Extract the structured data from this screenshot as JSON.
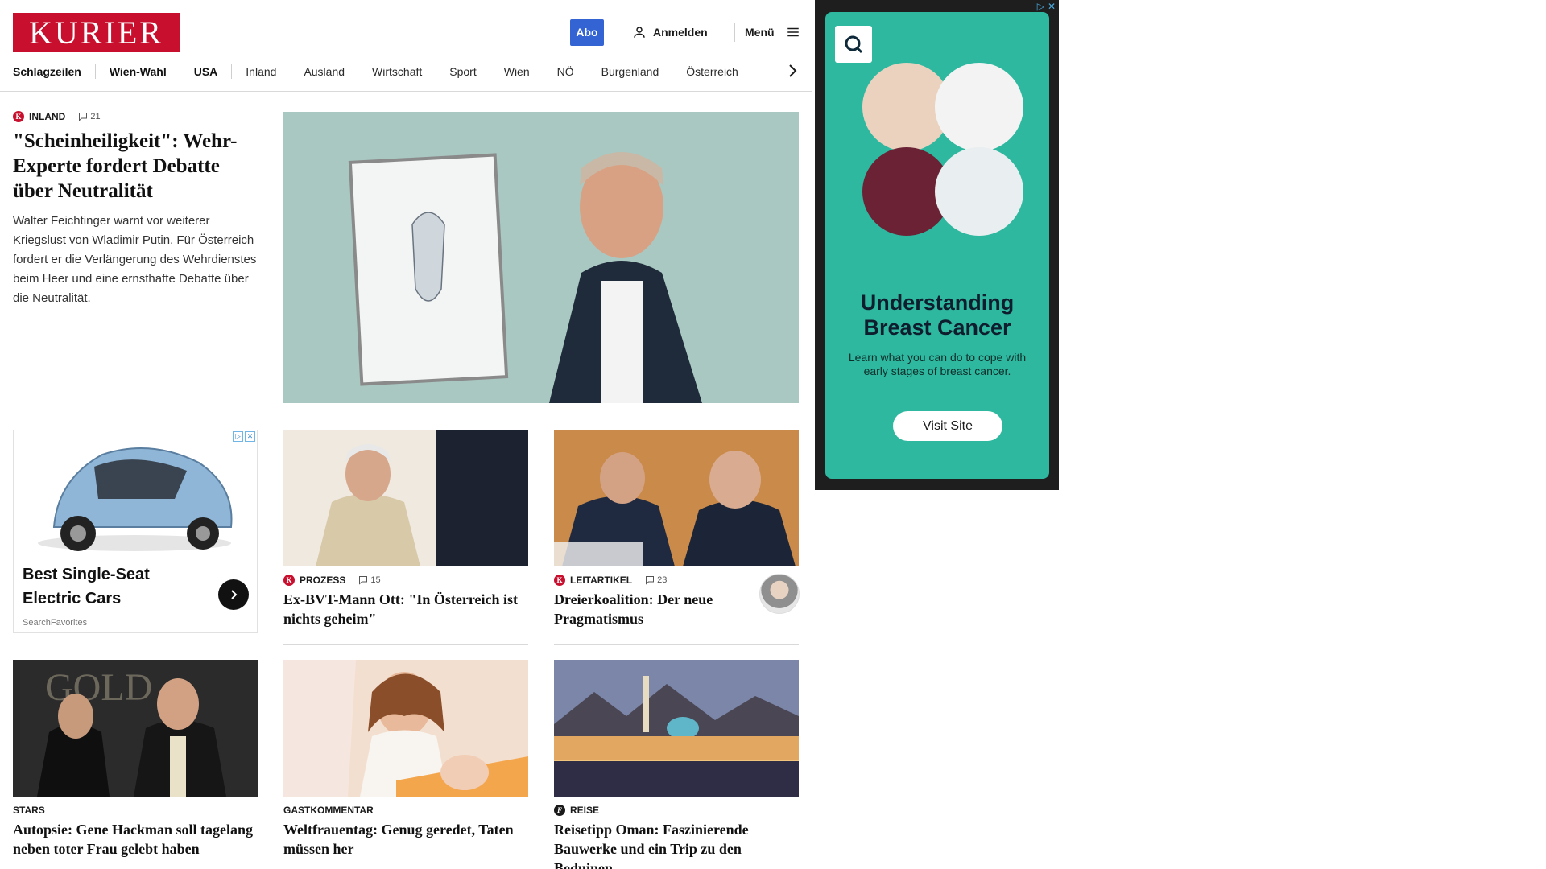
{
  "header": {
    "logo": "KURIER",
    "abo_label": "Abo",
    "login_label": "Anmelden",
    "menu_label": "Menü"
  },
  "nav": {
    "items": [
      "Schlagzeilen",
      "Wien-Wahl",
      "USA",
      "Inland",
      "Ausland",
      "Wirtschaft",
      "Sport",
      "Wien",
      "NÖ",
      "Burgenland",
      "Österreich"
    ]
  },
  "lead": {
    "category": "INLAND",
    "comments": "21",
    "title": "\"Scheinheiligkeit\": Wehr-Experte fordert Debatte über Neutralität",
    "description": "Walter Feichtinger warnt vor weiterer Kriegslust von Wladimir Putin. Für Österreich fordert er die Verlängerung des Wehrdienstes beim Heer und eine ernsthafte Debatte über die Neutralität."
  },
  "ad_card": {
    "title": "Best Single-Seat Electric Cars",
    "source": "SearchFavorites"
  },
  "cards": [
    {
      "category": "PROZESS",
      "comments": "15",
      "title": "Ex-BVT-Mann Ott: \"In Österreich ist nichts geheim\""
    },
    {
      "category": "LEITARTIKEL",
      "comments": "23",
      "title": "Dreierkoalition: Der neue Pragmatismus"
    },
    {
      "category": "STARS",
      "title": "Autopsie: Gene Hackman soll tagelang neben toter Frau gelebt haben"
    },
    {
      "category": "GASTKOMMENTAR",
      "title": "Weltfrauentag: Genug geredet, Taten müssen her"
    },
    {
      "category": "REISE",
      "title": "Reisetipp Oman: Faszinierende Bauwerke und ein Trip zu den Beduinen"
    }
  ],
  "right_ad": {
    "headline": "Understanding Breast Cancer",
    "subtext": "Learn what you can do to cope with early stages of breast cancer.",
    "cta": "Visit Site"
  },
  "colors": {
    "brand": "#c8102e",
    "abo": "#3463d4",
    "ad_teal": "#2fb8a0"
  }
}
